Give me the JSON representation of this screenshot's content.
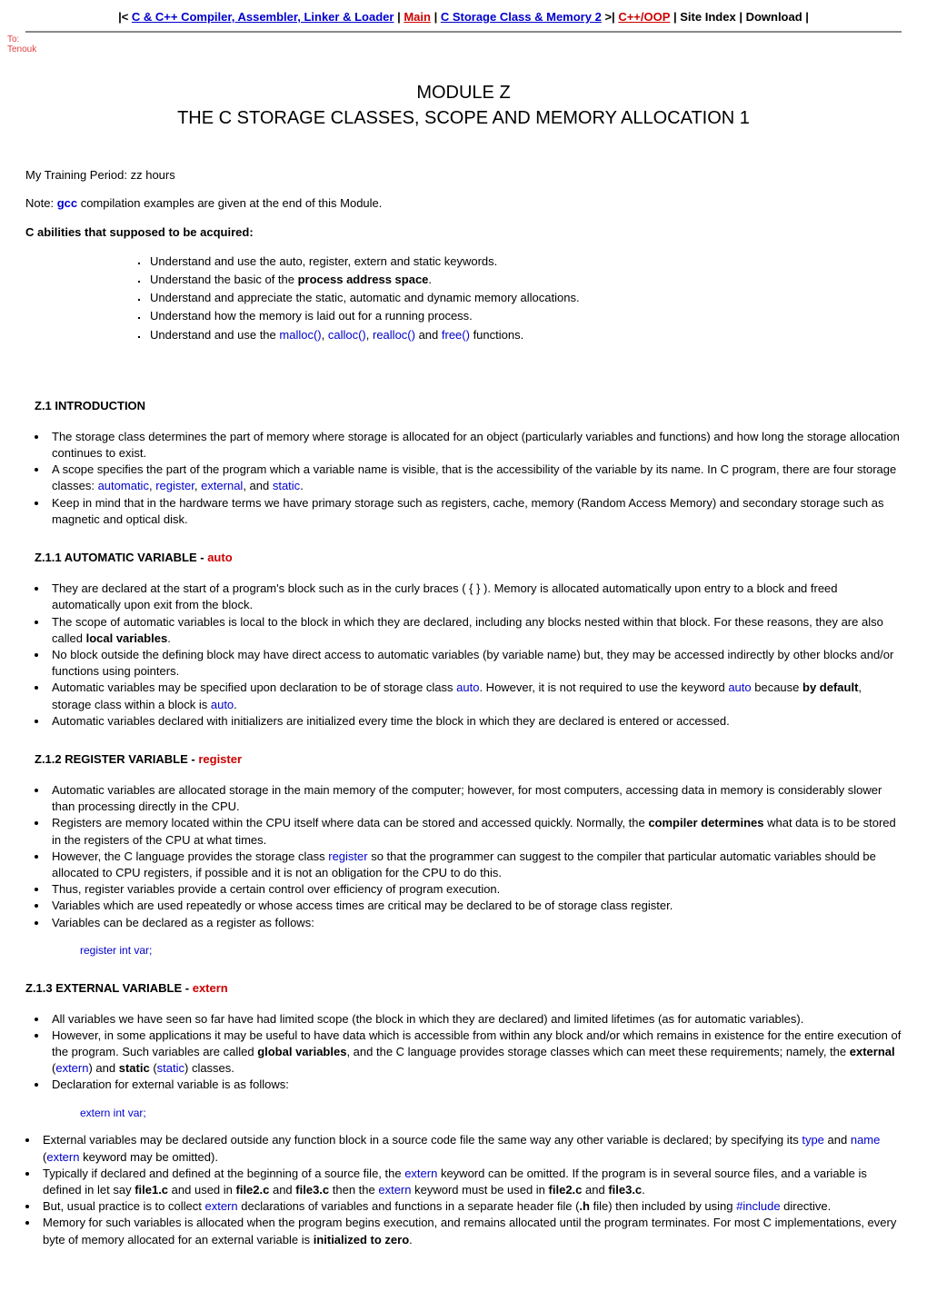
{
  "nav": {
    "l_arrow": "|<",
    "link1": "C & C++ Compiler, Assembler, Linker & Loader",
    "sep1": " | ",
    "main": "Main",
    "sep2": " | ",
    "link2": "C Storage Class & Memory 2",
    "r_arrow": ">|",
    "link3": "C++/OOP",
    "sep3": " | ",
    "siteindex": "Site Index",
    "sep4": " | ",
    "download": "Download",
    "end": " |"
  },
  "logo": {
    "l1": "To:",
    "l2": "Tenouk"
  },
  "title": {
    "l1": "MODULE Z",
    "l2": "THE C STORAGE CLASSES, SCOPE AND MEMORY ALLOCATION 1"
  },
  "intro": {
    "training": "My Training Period: zz  hours",
    "note_pre": "Note: ",
    "note_gcc": "gcc",
    "note_post": " compilation examples are given at the end of this Module.",
    "abilities_hdr": "C abilities that supposed to be acquired:"
  },
  "objectives": {
    "o1": "Understand and use the auto, register, extern and static keywords.",
    "o2a": "Understand the basic of the ",
    "o2b": "process address space",
    "o2c": ".",
    "o3": "Understand and appreciate the static, automatic and dynamic memory allocations.",
    "o4": "Understand how the memory is laid out for a running process.",
    "o5a": "Understand and use the ",
    "o5_malloc": "malloc()",
    "o5_s1": ", ",
    "o5_calloc": "calloc()",
    "o5_s2": ", ",
    "o5_realloc": "realloc()",
    "o5_and": " and ",
    "o5_free": "free()",
    "o5_end": " functions."
  },
  "s1": {
    "hdr": "Z.1  INTRODUCTION",
    "b1": "The storage class determines the part of memory where storage is allocated for an object (particularly variables and functions) and how long the storage allocation continues to exist.",
    "b2a": "A scope specifies the part of the program which a variable name is visible, that is the accessibility of the variable by its name.  In C program, there are four storage classes: ",
    "b2_auto": "automatic",
    "b2_s1": ", ",
    "b2_reg": "register",
    "b2_s2": ", ",
    "b2_ext": "external",
    "b2_and": ", and ",
    "b2_static": "static",
    "b2_end": ".",
    "b3": "Keep in mind that in the hardware terms we have primary storage such as registers, cache, memory (Random Access Memory) and secondary storage such as magnetic and optical disk."
  },
  "s11": {
    "hdr_a": "Z.1.1  AUTOMATIC VARIABLE - ",
    "hdr_b": "auto",
    "b1": "They are declared at the start of a program's block such as in the curly braces ( { } ).  Memory is allocated automatically upon entry to a block and freed automatically upon exit from the block.",
    "b2a": "The scope of automatic variables is local to the block in which they are declared, including any blocks nested within that block. For these reasons, they are also called ",
    "b2b": "local variables",
    "b2c": ".",
    "b3": "No block outside the defining block may have direct access to automatic variables (by variable name) but, they may be accessed indirectly by other blocks and/or functions using pointers.",
    "b4a": "Automatic variables may be specified upon declaration to be of storage class ",
    "b4_auto1": "auto",
    "b4b": ".  However, it is not required to use the keyword ",
    "b4_auto2": "auto",
    "b4c": " because ",
    "b4_bold": "by default",
    "b4d": ", storage class within a block is ",
    "b4_auto3": "auto",
    "b4e": ".",
    "b5": "Automatic variables declared with initializers are initialized every time the block in which they are declared is entered or accessed."
  },
  "s12": {
    "hdr_a": "Z.1.2  REGISTER VARIABLE - ",
    "hdr_b": "register",
    "b1": "Automatic variables are allocated storage in the main memory of the computer; however, for most computers, accessing data in memory is considerably slower than processing directly in the CPU.",
    "b2a": "Registers are memory located within the CPU itself where data can be stored and accessed quickly.  Normally, the ",
    "b2b": "compiler determines",
    "b2c": " what data is to be stored in the registers of the CPU at what times.",
    "b3a": "However, the C language provides the storage class ",
    "b3_reg": "register",
    "b3b": " so that the programmer can suggest to the compiler that particular automatic variables should be allocated to CPU registers, if possible and it is not an obligation for the CPU to do this.",
    "b4": "Thus, register variables provide a certain control over efficiency of program execution.",
    "b5": "Variables which are used repeatedly or whose access times are critical may be declared to be of storage class register.",
    "b6": "Variables can be declared as a register as follows:",
    "code": "register int var;"
  },
  "s13": {
    "hdr_a": "Z.1.3  EXTERNAL VARIABLE - ",
    "hdr_b": "extern",
    "b1": "All variables we have seen so far have had limited scope (the block in which they are declared) and limited lifetimes (as for automatic variables).",
    "b2a": "However, in some applications it may be useful to have data which is accessible from within any block and/or which remains in existence for the entire execution of the program.  Such variables are called ",
    "b2_gv": "global variables",
    "b2b": ", and the C language provides storage classes which can meet these requirements; namely, the ",
    "b2_ext": "external",
    "b2_lp": " (",
    "b2_extern": "extern",
    "b2_rp": ") and ",
    "b2_stat": "static",
    "b2_lp2": " (",
    "b2_static": "static",
    "b2_rp2": ") classes.",
    "b3": "Declaration for external variable is as follows:",
    "code": "extern int var;",
    "b4a": "External variables may be declared outside any function block in a source code file the same way any other variable is declared; by specifying its ",
    "b4_type": "type",
    "b4b": " and ",
    "b4_name": "name",
    "b4c": " (",
    "b4_extern": "extern",
    "b4d": " keyword may be omitted).",
    "b5a": "Typically if declared and defined at the beginning of a source file, the ",
    "b5_extern1": "extern",
    "b5b": " keyword can be omitted.  If the program is in several source files, and a variable is defined in let say ",
    "b5_f1": "file1.c",
    "b5c": " and used in ",
    "b5_f2": "file2.c",
    "b5d": " and ",
    "b5_f3": "file3.c",
    "b5e": " then the ",
    "b5_extern2": "extern",
    "b5f": " keyword must be used in ",
    "b5_f2b": "file2.c",
    "b5g": " and ",
    "b5_f3b": "file3.c",
    "b5h": ".",
    "b6a": "But, usual practice is to collect ",
    "b6_extern": "extern",
    "b6b": " declarations of variables and functions in a separate header file (",
    "b6_h": ".h",
    "b6c": " file) then included by using ",
    "b6_inc": "#include",
    "b6d": " directive.",
    "b7a": "Memory for such variables is allocated when the program begins execution, and remains allocated until the program terminates.  For most C implementations, every byte of memory allocated for an external variable is ",
    "b7b": "initialized to zero",
    "b7c": "."
  }
}
